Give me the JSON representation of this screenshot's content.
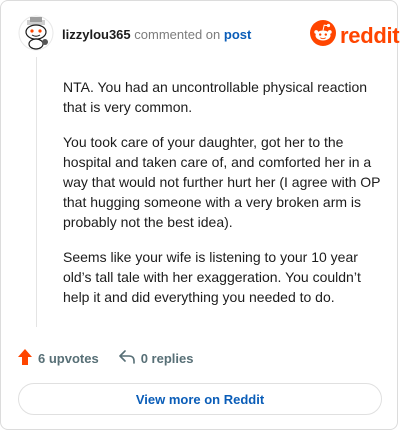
{
  "header": {
    "username": "lizzylou365",
    "commented_text": "commented on",
    "post_link": "post",
    "brand_wordmark": "reddit",
    "brand_color": "#ff4500",
    "avatar_icon": "snoo-avatar-icon",
    "logo_icon": "reddit-snoo-icon"
  },
  "comment": {
    "paragraphs": [
      "NTA. You had an uncontrollable physical reaction that is very common.",
      "You took care of your daughter, got her to the hospital and taken care of, and comforted her in a way that would not further hurt her (I agree with OP that hugging someone with a very broken arm is probably not the best idea).",
      "Seems like your wife is listening to your 10 year old’s tall tale with her exaggeration. You couldn’t help it and did everything you needed to do."
    ]
  },
  "actions": {
    "upvotes_label": "6 upvotes",
    "replies_label": "0 replies",
    "upvote_icon": "upvote-arrow-icon",
    "reply_icon": "reply-arrow-icon",
    "upvote_color": "#ff4500"
  },
  "footer": {
    "view_more_label": "View more on Reddit",
    "link_color": "#0a5db8"
  }
}
